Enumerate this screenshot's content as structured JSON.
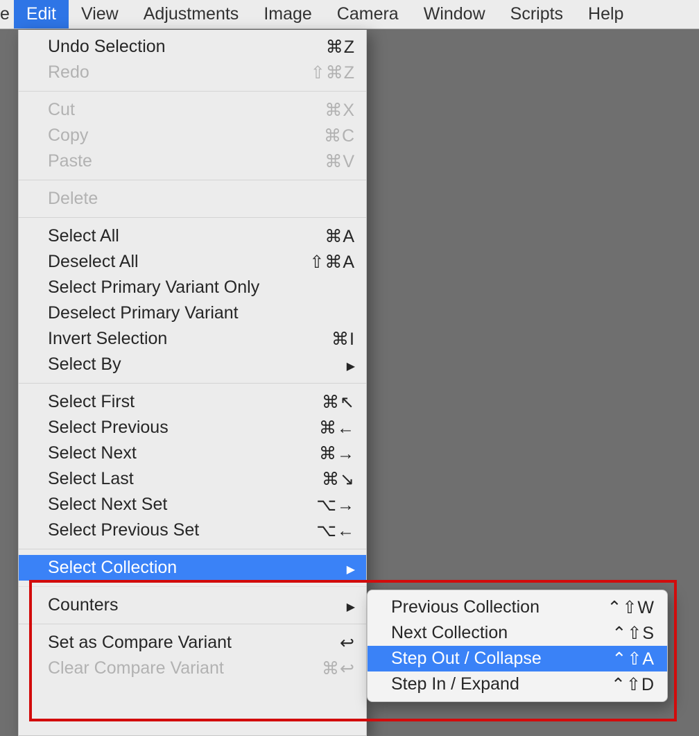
{
  "menubar": {
    "partial_left": "e",
    "items": [
      "Edit",
      "View",
      "Adjustments",
      "Image",
      "Camera",
      "Window",
      "Scripts",
      "Help"
    ],
    "selected_index": 0
  },
  "edit_menu": {
    "groups": [
      [
        {
          "label": "Undo Selection",
          "shortcut": "⌘Z",
          "disabled": false
        },
        {
          "label": "Redo",
          "shortcut": "⇧⌘Z",
          "disabled": true
        }
      ],
      [
        {
          "label": "Cut",
          "shortcut": "⌘X",
          "disabled": true
        },
        {
          "label": "Copy",
          "shortcut": "⌘C",
          "disabled": true
        },
        {
          "label": "Paste",
          "shortcut": "⌘V",
          "disabled": true
        }
      ],
      [
        {
          "label": "Delete",
          "shortcut": "",
          "disabled": true
        }
      ],
      [
        {
          "label": "Select All",
          "shortcut": "⌘A",
          "disabled": false
        },
        {
          "label": "Deselect All",
          "shortcut": "⇧⌘A",
          "disabled": false
        },
        {
          "label": "Select Primary Variant Only",
          "shortcut": "",
          "disabled": false
        },
        {
          "label": "Deselect Primary Variant",
          "shortcut": "",
          "disabled": false
        },
        {
          "label": "Invert Selection",
          "shortcut": "⌘I",
          "disabled": false
        },
        {
          "label": "Select By",
          "shortcut": "",
          "submenu": true,
          "disabled": false
        }
      ],
      [
        {
          "label": "Select First",
          "shortcut": "⌘↖",
          "disabled": false
        },
        {
          "label": "Select Previous",
          "shortcut": "⌘←",
          "disabled": false
        },
        {
          "label": "Select Next",
          "shortcut": "⌘→",
          "disabled": false
        },
        {
          "label": "Select Last",
          "shortcut": "⌘↘",
          "disabled": false
        },
        {
          "label": "Select Next Set",
          "shortcut": "⌥→",
          "disabled": false
        },
        {
          "label": "Select Previous Set",
          "shortcut": "⌥←",
          "disabled": false
        }
      ],
      [
        {
          "label": "Select Collection",
          "shortcut": "",
          "submenu": true,
          "highlight": true,
          "disabled": false
        }
      ],
      [
        {
          "label": "Counters",
          "shortcut": "",
          "submenu": true,
          "disabled": false
        }
      ],
      [
        {
          "label": "Set as Compare Variant",
          "shortcut": "↩",
          "disabled": false
        },
        {
          "label": "Clear Compare Variant",
          "shortcut": "⌘↩",
          "disabled": true
        }
      ]
    ]
  },
  "select_collection_submenu": {
    "items": [
      {
        "label": "Previous Collection",
        "shortcut": "⌃⇧W",
        "highlight": false
      },
      {
        "label": "Next Collection",
        "shortcut": "⌃⇧S",
        "highlight": false
      },
      {
        "label": "Step Out / Collapse",
        "shortcut": "⌃⇧A",
        "highlight": true
      },
      {
        "label": "Step In / Expand",
        "shortcut": "⌃⇧D",
        "highlight": false
      }
    ]
  }
}
